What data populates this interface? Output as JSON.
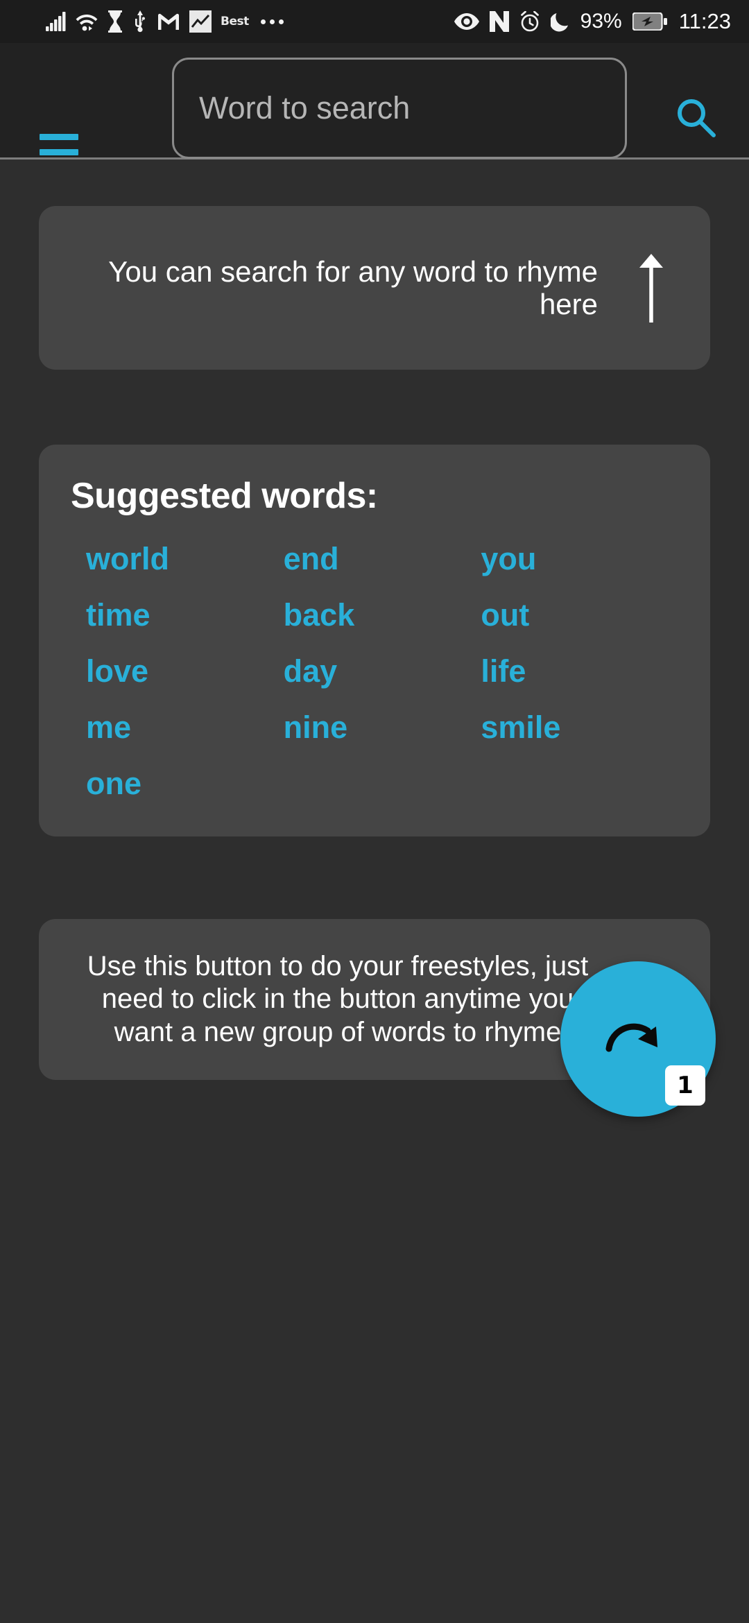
{
  "status_bar": {
    "left_icons": [
      "signal-bars-icon",
      "wifi-icon",
      "hourglass-icon",
      "usb-icon",
      "gmail-icon",
      "chart-app-icon",
      "best-app-icon",
      "more-dots-icon"
    ],
    "best_label": "Best",
    "right_icons": [
      "eye-icon",
      "nfc-icon",
      "alarm-icon",
      "do-not-disturb-moon-icon",
      "battery-charging-icon"
    ],
    "battery_percent": "93%",
    "clock": "11:23"
  },
  "app_bar": {
    "menu_label": "menu",
    "search_value": "",
    "search_placeholder": "Word to search",
    "search_button_label": "search"
  },
  "hint_top": {
    "text": "You can search for any word to rhyme here",
    "arrow": "arrow-up"
  },
  "suggested": {
    "title": "Suggested words:",
    "words": [
      "world",
      "end",
      "you",
      "time",
      "back",
      "out",
      "love",
      "day",
      "life",
      "me",
      "nine",
      "smile",
      "one"
    ]
  },
  "hint_bottom": {
    "text": "Use this button to do your freestyles, just need to click in the button anytime you want a new group of words to rhyme",
    "arrow": "arrow-down"
  },
  "fab": {
    "icon": "redo-arrow-icon",
    "label": "new words"
  },
  "page_badge": {
    "value": "1"
  },
  "colors": {
    "accent": "#29b0d9",
    "page_background": "#2e2e2e",
    "card_background": "#454545",
    "app_bar_background": "#222222",
    "status_bar_background": "#1c1c1c",
    "text_primary": "#ffffff",
    "placeholder": "#b6b6b6"
  }
}
